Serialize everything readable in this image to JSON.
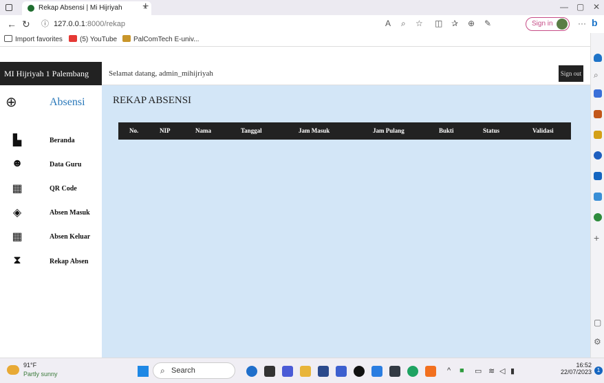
{
  "browser": {
    "tab_title": "Rekap Absensi | Mi Hijriyah",
    "tab_close": "×",
    "new_tab": "+",
    "url_host": "127.0.0.1",
    "url_path": ":8000/rekap",
    "signin_label": "Sign in",
    "more_label": "···",
    "favorites": [
      {
        "label": "Import favorites",
        "icon": "folder-icon"
      },
      {
        "label": "(5) YouTube",
        "icon": "youtube-icon"
      },
      {
        "label": "PalComTech E-univ...",
        "icon": "palcomtech-icon"
      }
    ]
  },
  "app": {
    "site_name": "MI Hijriyah 1 Palembang",
    "welcome_text": "Selamat datang, admin_mihijriyah",
    "signout_label": "Sign out",
    "brand_label": "Absensi",
    "menu": [
      {
        "label": "Beranda",
        "icon": "home-icon"
      },
      {
        "label": "Data Guru",
        "icon": "user-icon"
      },
      {
        "label": "QR Code",
        "icon": "qr-code-icon"
      },
      {
        "label": "Absen Masuk",
        "icon": "layers-icon"
      },
      {
        "label": "Absen Keluar",
        "icon": "qr-code-icon"
      },
      {
        "label": "Rekap Absen",
        "icon": "hourglass-icon"
      }
    ],
    "page_title": "REKAP ABSENSI",
    "table_headers": [
      "No.",
      "NIP",
      "Nama",
      "Tanggal",
      "Jam Masuk",
      "Jam Pulang",
      "Bukti",
      "Status",
      "Validasi"
    ]
  },
  "taskbar": {
    "temperature": "91°F",
    "condition": "Partly sunny",
    "search_label": "Search",
    "time": "16:52",
    "date": "22/07/2023",
    "notification_count": "1"
  },
  "colors": {
    "content_bg": "#d3e6f7",
    "dark_bar": "#222222",
    "brand_blue": "#2877b9"
  }
}
